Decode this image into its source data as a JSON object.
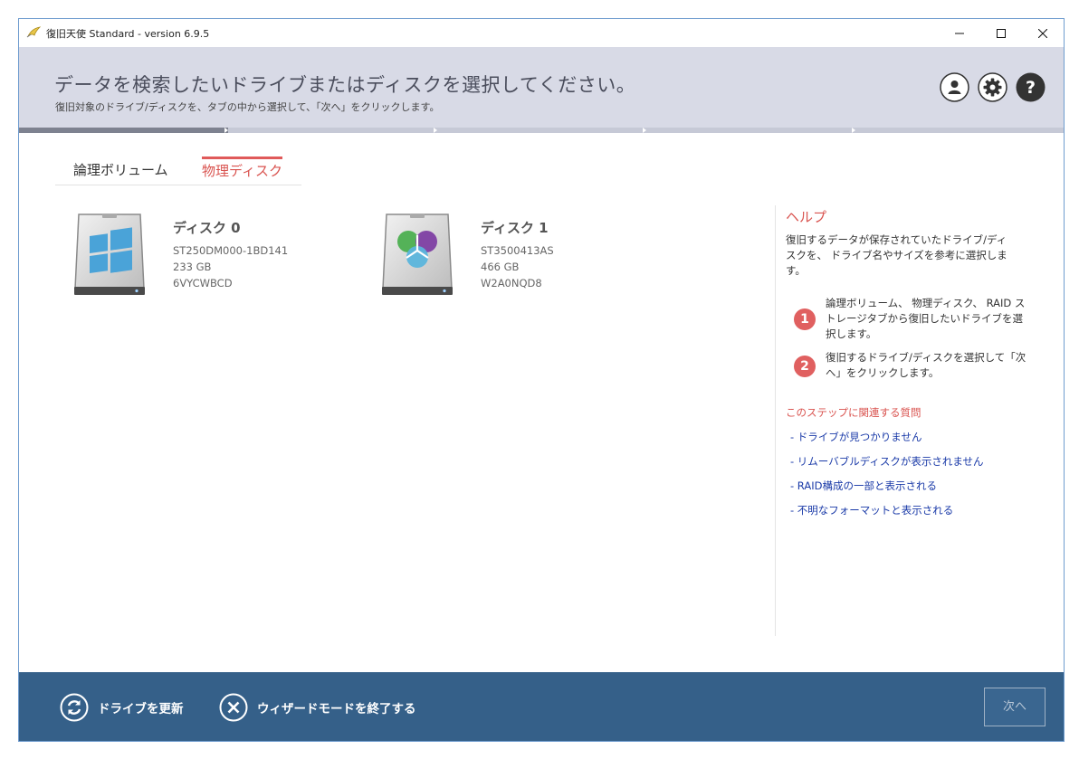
{
  "window": {
    "title": "復旧天使 Standard - version 6.9.5",
    "app_icon": "wing-logo-icon"
  },
  "header": {
    "title": "データを検索したいドライブまたはディスクを選択してください。",
    "subtitle": "復旧対象のドライブ/ディスクを、タブの中から選択して、「次へ」をクリックします。",
    "icons": [
      "user-icon",
      "gear-icon",
      "help-icon"
    ],
    "help_glyph": "?"
  },
  "progress": {
    "value": 0.2,
    "steps": 5
  },
  "tabs": [
    {
      "label": "論理ボリューム",
      "active": false
    },
    {
      "label": "物理ディスク",
      "active": true
    }
  ],
  "disks": [
    {
      "name": "ディスク 0",
      "model": "ST250DM000-1BD141",
      "size": "233 GB",
      "serial": "6VYCWBCD",
      "icon": "windows-drive-icon"
    },
    {
      "name": "ディスク 1",
      "model": "ST3500413AS",
      "size": "466 GB",
      "serial": "W2A0NQD8",
      "icon": "multi-partition-drive-icon"
    }
  ],
  "help": {
    "title": "ヘルプ",
    "intro": "復旧するデータが保存されていたドライブ/ディスクを、 ドライブ名やサイズを参考に選択します。",
    "steps": [
      {
        "num": "1",
        "text": "論理ボリューム、 物理ディスク、 RAID ストレージタブから復旧したいドライブを選択します。"
      },
      {
        "num": "2",
        "text": "復旧するドライブ/ディスクを選択して「次へ」をクリックします。"
      }
    ],
    "faq_title": "このステップに関連する質問",
    "faq_links": [
      "- ドライブが見つかりません",
      "- リムーバブルディスクが表示されません",
      "- RAID構成の一部と表示される",
      "- 不明なフォーマットと表示される"
    ]
  },
  "footer": {
    "refresh_label": "ドライブを更新",
    "exit_label": "ウィザードモードを終了する",
    "next_label": "次へ"
  },
  "colors": {
    "header_bg": "#d8dae6",
    "accent_red": "#d9534f",
    "footer_bg": "#356089",
    "link_blue": "#1a3aa8"
  }
}
